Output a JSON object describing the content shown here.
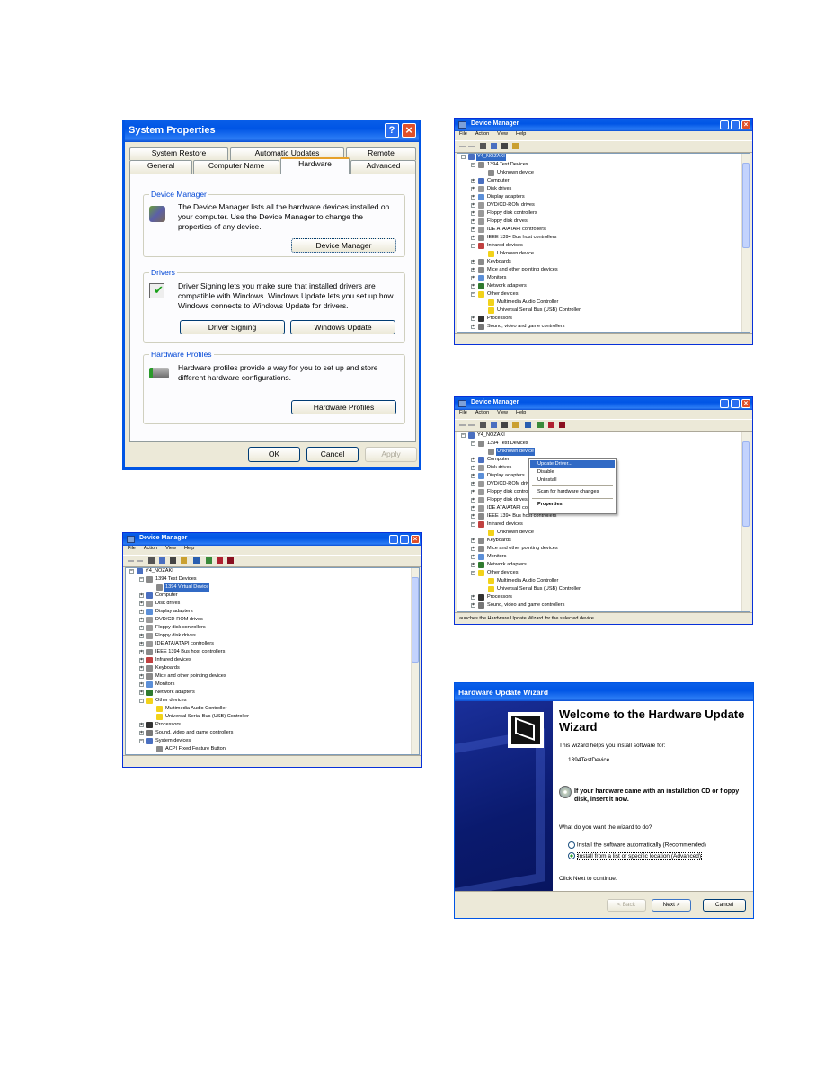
{
  "system_properties": {
    "title": "System Properties",
    "help_button": "?",
    "close_button": "×",
    "tabs_row1": [
      "System Restore",
      "Automatic Updates",
      "Remote"
    ],
    "tabs_row2": [
      "General",
      "Computer Name",
      "Hardware",
      "Advanced"
    ],
    "active_tab": "Hardware",
    "groups": [
      {
        "label": "Device Manager",
        "text": "The Device Manager lists all the hardware devices installed on your computer. Use the Device Manager to change the properties of any device.",
        "buttons": [
          "Device Manager"
        ],
        "icon": "device-manager-icon"
      },
      {
        "label": "Drivers",
        "text": "Driver Signing lets you make sure that installed drivers are compatible with Windows. Windows Update lets you set up how Windows connects to Windows Update for drivers.",
        "buttons": [
          "Driver Signing",
          "Windows Update"
        ],
        "icon": "driver-signing-icon"
      },
      {
        "label": "Hardware Profiles",
        "text": "Hardware profiles provide a way for you to set up and store different hardware configurations.",
        "buttons": [
          "Hardware Profiles"
        ],
        "icon": "hardware-profiles-icon"
      }
    ],
    "footer_buttons": [
      "OK",
      "Cancel",
      "Apply"
    ],
    "title_color": "#0055e5"
  },
  "dm_windows": [
    {
      "title": "Device Manager",
      "menu": [
        "File",
        "Action",
        "View",
        "Help"
      ],
      "toolbar_icons": [
        "back-icon",
        "forward-icon",
        "properties-icon",
        "print-icon",
        "help-icon",
        "computer-icon"
      ],
      "status": "",
      "tree": [
        {
          "label": "Y4_NOZAKI",
          "depth": 0,
          "exp": "-",
          "icon": "computer",
          "selected": true
        },
        {
          "label": "1394 Test Devices",
          "depth": 1,
          "exp": "-",
          "icon": "device"
        },
        {
          "label": "Unknown device",
          "depth": 2,
          "exp": "",
          "icon": "device"
        },
        {
          "label": "Computer",
          "depth": 1,
          "exp": "+",
          "icon": "computer"
        },
        {
          "label": "Disk drives",
          "depth": 1,
          "exp": "+",
          "icon": "disk"
        },
        {
          "label": "Display adapters",
          "depth": 1,
          "exp": "+",
          "icon": "monitor"
        },
        {
          "label": "DVD/CD-ROM drives",
          "depth": 1,
          "exp": "+",
          "icon": "disk"
        },
        {
          "label": "Floppy disk controllers",
          "depth": 1,
          "exp": "+",
          "icon": "disk"
        },
        {
          "label": "Floppy disk drives",
          "depth": 1,
          "exp": "+",
          "icon": "disk"
        },
        {
          "label": "IDE ATA/ATAPI controllers",
          "depth": 1,
          "exp": "+",
          "icon": "disk"
        },
        {
          "label": "IEEE 1394 Bus host controllers",
          "depth": 1,
          "exp": "+",
          "icon": "device"
        },
        {
          "label": "Infrared devices",
          "depth": 1,
          "exp": "-",
          "icon": "infrared"
        },
        {
          "label": "Unknown device",
          "depth": 2,
          "exp": "",
          "icon": "warning"
        },
        {
          "label": "Keyboards",
          "depth": 1,
          "exp": "+",
          "icon": "device"
        },
        {
          "label": "Mice and other pointing devices",
          "depth": 1,
          "exp": "+",
          "icon": "device"
        },
        {
          "label": "Monitors",
          "depth": 1,
          "exp": "+",
          "icon": "monitor"
        },
        {
          "label": "Network adapters",
          "depth": 1,
          "exp": "+",
          "icon": "network"
        },
        {
          "label": "Other devices",
          "depth": 1,
          "exp": "-",
          "icon": "warning"
        },
        {
          "label": "Multimedia Audio Controller",
          "depth": 2,
          "exp": "",
          "icon": "warning"
        },
        {
          "label": "Universal Serial Bus (USB) Controller",
          "depth": 2,
          "exp": "",
          "icon": "warning"
        },
        {
          "label": "Processors",
          "depth": 1,
          "exp": "+",
          "icon": "chip"
        },
        {
          "label": "Sound, video and game controllers",
          "depth": 1,
          "exp": "+",
          "icon": "sound"
        }
      ]
    },
    {
      "title": "Device Manager",
      "menu": [
        "File",
        "Action",
        "View",
        "Help"
      ],
      "toolbar_icons": [
        "back-icon",
        "forward-icon",
        "properties-icon",
        "update-icon",
        "print-icon",
        "help-icon",
        "computer-icon",
        "scan-icon",
        "disable-icon",
        "uninstall-icon"
      ],
      "status": "Launches the Hardware Update Wizard for the selected device.",
      "context_menu": [
        {
          "label": "Update Driver...",
          "highlighted": true
        },
        {
          "label": "Disable"
        },
        {
          "label": "Uninstall"
        },
        {
          "separator": true
        },
        {
          "label": "Scan for hardware changes"
        },
        {
          "separator": true
        },
        {
          "label": "Properties",
          "bold": true
        }
      ],
      "tree": [
        {
          "label": "Y4_NOZAKI",
          "depth": 0,
          "exp": "-",
          "icon": "computer"
        },
        {
          "label": "1394 Test Devices",
          "depth": 1,
          "exp": "-",
          "icon": "device"
        },
        {
          "label": "Unknown device",
          "depth": 2,
          "exp": "",
          "icon": "device",
          "selected": true
        },
        {
          "label": "Computer",
          "depth": 1,
          "exp": "+",
          "icon": "computer"
        },
        {
          "label": "Disk drives",
          "depth": 1,
          "exp": "+",
          "icon": "disk"
        },
        {
          "label": "Display adapters",
          "depth": 1,
          "exp": "+",
          "icon": "monitor"
        },
        {
          "label": "DVD/CD-ROM drives",
          "depth": 1,
          "exp": "+",
          "icon": "disk"
        },
        {
          "label": "Floppy disk controllers",
          "depth": 1,
          "exp": "+",
          "icon": "disk"
        },
        {
          "label": "Floppy disk drives",
          "depth": 1,
          "exp": "+",
          "icon": "disk"
        },
        {
          "label": "IDE ATA/ATAPI controllers",
          "depth": 1,
          "exp": "+",
          "icon": "disk"
        },
        {
          "label": "IEEE 1394 Bus host controllers",
          "depth": 1,
          "exp": "+",
          "icon": "device"
        },
        {
          "label": "Infrared devices",
          "depth": 1,
          "exp": "-",
          "icon": "infrared"
        },
        {
          "label": "Unknown device",
          "depth": 2,
          "exp": "",
          "icon": "warning"
        },
        {
          "label": "Keyboards",
          "depth": 1,
          "exp": "+",
          "icon": "device"
        },
        {
          "label": "Mice and other pointing devices",
          "depth": 1,
          "exp": "+",
          "icon": "device"
        },
        {
          "label": "Monitors",
          "depth": 1,
          "exp": "+",
          "icon": "monitor"
        },
        {
          "label": "Network adapters",
          "depth": 1,
          "exp": "+",
          "icon": "network"
        },
        {
          "label": "Other devices",
          "depth": 1,
          "exp": "-",
          "icon": "warning"
        },
        {
          "label": "Multimedia Audio Controller",
          "depth": 2,
          "exp": "",
          "icon": "warning"
        },
        {
          "label": "Universal Serial Bus (USB) Controller",
          "depth": 2,
          "exp": "",
          "icon": "warning"
        },
        {
          "label": "Processors",
          "depth": 1,
          "exp": "+",
          "icon": "chip"
        },
        {
          "label": "Sound, video and game controllers",
          "depth": 1,
          "exp": "+",
          "icon": "sound"
        }
      ]
    },
    {
      "title": "Device Manager",
      "menu": [
        "File",
        "Action",
        "View",
        "Help"
      ],
      "toolbar_icons": [
        "back-icon",
        "forward-icon",
        "properties-icon",
        "update-icon",
        "print-icon",
        "help-icon",
        "computer-icon",
        "scan-icon",
        "disable-icon",
        "uninstall-icon"
      ],
      "status": "",
      "tree": [
        {
          "label": "Y4_NOZAKI",
          "depth": 0,
          "exp": "-",
          "icon": "computer"
        },
        {
          "label": "1394 Test Devices",
          "depth": 1,
          "exp": "-",
          "icon": "device"
        },
        {
          "label": "1394 Virtual Device",
          "depth": 2,
          "exp": "",
          "icon": "device",
          "selected": true
        },
        {
          "label": "Computer",
          "depth": 1,
          "exp": "+",
          "icon": "computer"
        },
        {
          "label": "Disk drives",
          "depth": 1,
          "exp": "+",
          "icon": "disk"
        },
        {
          "label": "Display adapters",
          "depth": 1,
          "exp": "+",
          "icon": "monitor"
        },
        {
          "label": "DVD/CD-ROM drives",
          "depth": 1,
          "exp": "+",
          "icon": "disk"
        },
        {
          "label": "Floppy disk controllers",
          "depth": 1,
          "exp": "+",
          "icon": "disk"
        },
        {
          "label": "Floppy disk drives",
          "depth": 1,
          "exp": "+",
          "icon": "disk"
        },
        {
          "label": "IDE ATA/ATAPI controllers",
          "depth": 1,
          "exp": "+",
          "icon": "disk"
        },
        {
          "label": "IEEE 1394 Bus host controllers",
          "depth": 1,
          "exp": "+",
          "icon": "device"
        },
        {
          "label": "Infrared devices",
          "depth": 1,
          "exp": "+",
          "icon": "infrared"
        },
        {
          "label": "Keyboards",
          "depth": 1,
          "exp": "+",
          "icon": "device"
        },
        {
          "label": "Mice and other pointing devices",
          "depth": 1,
          "exp": "+",
          "icon": "device"
        },
        {
          "label": "Monitors",
          "depth": 1,
          "exp": "+",
          "icon": "monitor"
        },
        {
          "label": "Network adapters",
          "depth": 1,
          "exp": "+",
          "icon": "network"
        },
        {
          "label": "Other devices",
          "depth": 1,
          "exp": "-",
          "icon": "warning"
        },
        {
          "label": "Multimedia Audio Controller",
          "depth": 2,
          "exp": "",
          "icon": "warning"
        },
        {
          "label": "Universal Serial Bus (USB) Controller",
          "depth": 2,
          "exp": "",
          "icon": "warning"
        },
        {
          "label": "Processors",
          "depth": 1,
          "exp": "+",
          "icon": "chip"
        },
        {
          "label": "Sound, video and game controllers",
          "depth": 1,
          "exp": "+",
          "icon": "sound"
        },
        {
          "label": "System devices",
          "depth": 1,
          "exp": "-",
          "icon": "computer"
        },
        {
          "label": "ACPI Fixed Feature Button",
          "depth": 2,
          "exp": "",
          "icon": "device"
        }
      ]
    }
  ],
  "wizard": {
    "title": "Hardware Update Wizard",
    "heading": "Welcome to the Hardware Update Wizard",
    "intro": "This wizard helps you install software for:",
    "device": "1394TestDevice",
    "cd_prompt": "If your hardware came with an installation CD or floppy disk, insert it now.",
    "question": "What do you want the wizard to do?",
    "options": [
      {
        "label": "Install the software automatically (Recommended)",
        "checked": false
      },
      {
        "label": "Install from a list or specific location (Advanced)",
        "checked": true
      }
    ],
    "continue_text": "Click Next to continue.",
    "buttons": {
      "back": "< Back",
      "next": "Next >",
      "cancel": "Cancel"
    },
    "side_color": "#0a1a6e"
  }
}
